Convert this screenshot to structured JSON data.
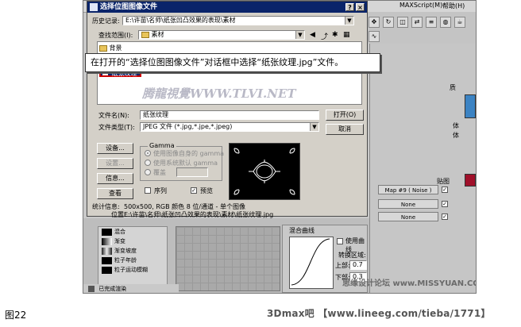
{
  "background_app": {
    "menu_items": [
      "MAXScript(M)",
      "帮助(H)"
    ],
    "panel": {
      "map_label": "贴图",
      "map_button": "Map #9 ( Noise )",
      "none_button_1": "None",
      "none_button_2": "None",
      "side_labels": [
        "质",
        "体",
        "体"
      ],
      "curve_panel_title": "混合曲线",
      "use_curve_label": "使用曲线",
      "transition_zone_label": "转换区域:",
      "upper_label": "上部:",
      "upper_value": "0.7",
      "lower_label": "下部:",
      "lower_value": "0.3"
    },
    "material_list": [
      "混合",
      "渐变",
      "渐变坡度",
      "粒子年龄",
      "粒子运动模糊"
    ],
    "status_text": "已完成渲染"
  },
  "dialog": {
    "title": "选择位图图像文件",
    "close_symbol": "×",
    "help_symbol": "?",
    "history_label": "历史记录:",
    "history_value": "E:\\许苗\\名师\\纸张凹凸效果的表现\\素材",
    "lookin_label": "查找范围(I):",
    "lookin_value": "素材",
    "folders": [
      "背景"
    ],
    "selected_file": "纸张纹理",
    "filename_label": "文件名(N):",
    "filename_value": "纸张纹理",
    "filetype_label": "文件类型(T):",
    "filetype_value": "JPEG 文件 (*.jpg,*.jpe,*.jpeg)",
    "open_button": "打开(O)",
    "cancel_button": "取消",
    "gamma_group_label": "Gamma",
    "gamma_options": [
      "使用图像自身的 gamma",
      "使用系统默认 gamma",
      "覆盖"
    ],
    "setup_button": "设备...",
    "settings_button": "设置...",
    "info_button": "信息...",
    "view_button": "查看",
    "sequence_label": "序列",
    "preview_label": "预览",
    "stats_label": "统计信息:",
    "stats_value": "500x500, RGB 颜色 8 位/通道 - 单个图像",
    "location_label": "位置:",
    "location_value": "E:\\许苗\\名师\\纸张凹凸效果的表现\\素材\\纸张纹理.jpg"
  },
  "callout_text": "在打开的“选择位图图像文件”对话框中选择“纸张纹理.jpg”文件。",
  "watermark_text": "腾龍視覺WWW.TLVI.NET",
  "site_watermark": "思缘设计论坛 www.MISSYUAN.COM",
  "caption": "图22",
  "footer": "3Dmax吧 【www.lineeg.com/tieba/1771】",
  "colors": {
    "titlebar": "#0a246a",
    "selection_border": "#cc0000",
    "swatch_blue": "#3c83c3",
    "swatch_red": "#a0102a"
  }
}
